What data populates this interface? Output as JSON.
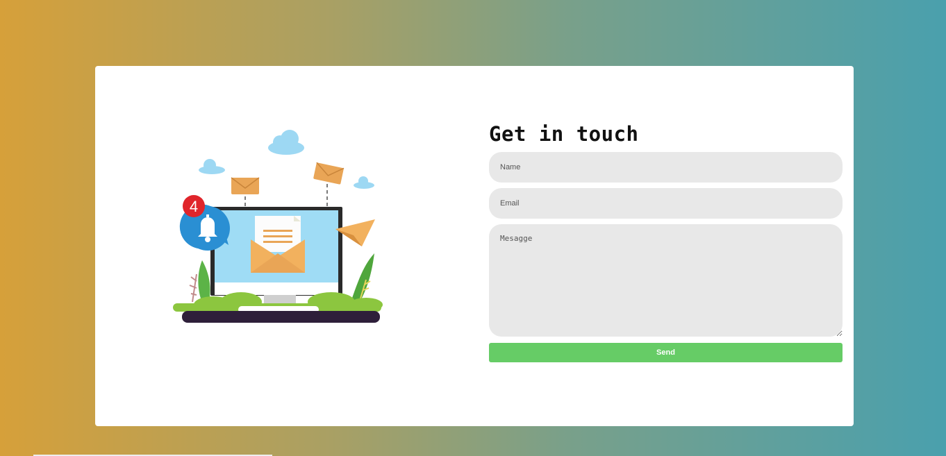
{
  "form": {
    "title": "Get in touch",
    "name_placeholder": "Name",
    "email_placeholder": "Email",
    "message_placeholder": "Mesagge",
    "send_label": "Send"
  },
  "illustration": {
    "notification_count": "4"
  },
  "colors": {
    "gradient_start": "#d6a03a",
    "gradient_end": "#4aa0ad",
    "send_button": "#66cc66",
    "field_background": "#e8e8e8"
  }
}
